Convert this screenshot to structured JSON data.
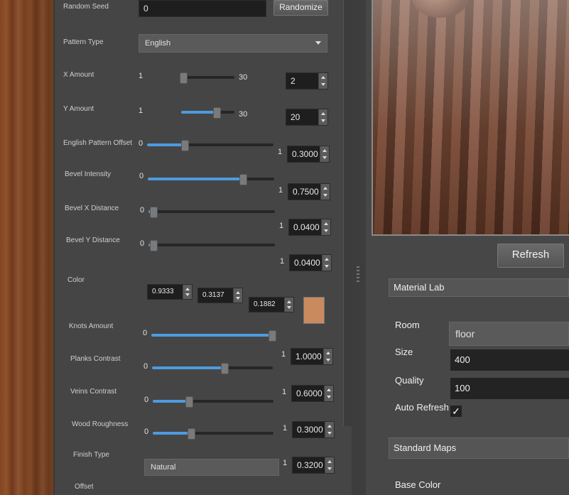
{
  "left": {
    "random_seed": {
      "label": "Random Seed",
      "value": "0",
      "button": "Randomize"
    },
    "pattern_type": {
      "label": "Pattern Type",
      "value": "English"
    },
    "x_amount": {
      "label": "X Amount",
      "min": "1",
      "max": "30",
      "value": "2"
    },
    "y_amount": {
      "label": "Y Amount",
      "min": "1",
      "max": "30",
      "value": "20"
    },
    "english_offset": {
      "label": "English Pattern Offset",
      "min": "0",
      "max": "1",
      "value": "0.3000"
    },
    "bevel_intensity": {
      "label": "Bevel Intensity",
      "min": "0",
      "max": "1",
      "value": "0.7500"
    },
    "bevel_x": {
      "label": "Bevel X Distance",
      "min": "0",
      "max": "1",
      "value": "0.0400"
    },
    "bevel_y": {
      "label": "Bevel Y Distance",
      "min": "0",
      "max": "1",
      "value": "0.0400"
    },
    "color": {
      "label": "Color",
      "r": "0.9333",
      "g": "0.3137",
      "b": "0.1882",
      "swatch": "#c98a5e"
    },
    "knots_amount": {
      "label": "Knots Amount",
      "min": "0",
      "max": "1",
      "value": "1.0000"
    },
    "planks_contrast": {
      "label": "Planks Contrast",
      "min": "0",
      "max": "1",
      "value": "0.6000"
    },
    "veins_contrast": {
      "label": "Veins Contrast",
      "min": "0",
      "max": "1",
      "value": "0.3000"
    },
    "wood_roughness": {
      "label": "Wood Roughness",
      "min": "0",
      "max": "1",
      "value": "0.3200"
    },
    "finish_type": {
      "label": "Finish Type",
      "value": "Natural"
    },
    "offset": {
      "label": "Offset"
    }
  },
  "right": {
    "refresh": "Refresh",
    "material_lab": "Material Lab",
    "room_label": "Room",
    "room_value": "floor",
    "size_label": "Size",
    "size_value": "400",
    "quality_label": "Quality",
    "quality_value": "100",
    "auto_refresh_label": "Auto Refresh",
    "auto_refresh_check": "✓",
    "standard_maps": "Standard Maps",
    "base_color": "Base Color"
  },
  "sliders": {
    "x_amount": 0.04,
    "y_amount": 0.66,
    "english_offset": 0.3,
    "bevel_intensity": 0.75,
    "bevel_x": 0.04,
    "bevel_y": 0.04,
    "knots_amount": 1.0,
    "planks_contrast": 0.6,
    "veins_contrast": 0.3,
    "wood_roughness": 0.32
  },
  "colors": {
    "accent": "#4d9be0",
    "panel": "#454545"
  }
}
